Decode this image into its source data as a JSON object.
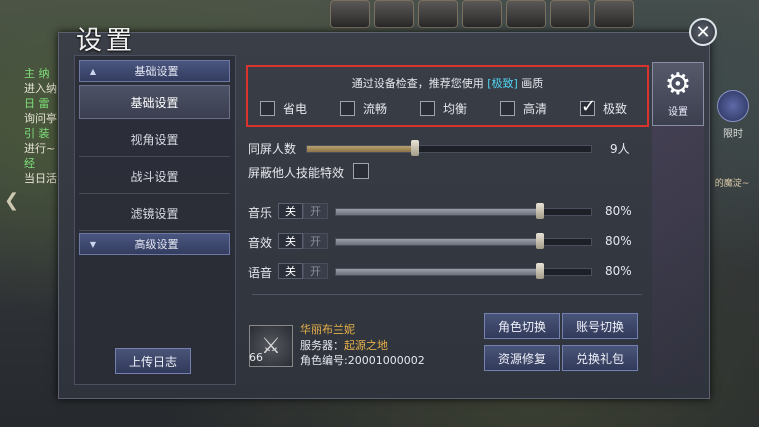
{
  "title": "设置",
  "sidebar": {
    "section_basic": "基础设置",
    "items": [
      "基础设置",
      "视角设置",
      "战斗设置",
      "滤镜设置"
    ],
    "section_advanced": "高级设置",
    "upload_log": "上传日志"
  },
  "settings_tab_label": "设置",
  "quality": {
    "tip_prefix": "通过设备检查，推荐您使用",
    "tip_highlight": "[极致]",
    "tip_suffix": "画质",
    "options": [
      "省电",
      "流畅",
      "均衡",
      "高清",
      "极致"
    ],
    "selected": "极致"
  },
  "same_screen": {
    "label": "同屏人数",
    "value": "9人",
    "level": 0.38
  },
  "hide_skill_effects": {
    "label": "屏蔽他人技能特效",
    "checked": false
  },
  "audio": [
    {
      "label": "音乐",
      "off": "关",
      "on": "开",
      "value": "80%",
      "level": 0.8
    },
    {
      "label": "音效",
      "off": "关",
      "on": "开",
      "value": "80%",
      "level": 0.8
    },
    {
      "label": "语音",
      "off": "关",
      "on": "开",
      "value": "80%",
      "level": 0.8
    }
  ],
  "character": {
    "name": "华丽布兰妮",
    "server_label": "服务器：",
    "server_name": "起源之地",
    "id_text": "角色编号:20001000002",
    "level": "66"
  },
  "buttons": {
    "switch_role": "角色切换",
    "switch_account": "账号切换",
    "repair_resources": "资源修复",
    "redeem_gift": "兑换礼包"
  },
  "hud": {
    "left_lines": [
      "主 纳",
      "进入纳",
      "日 雷",
      "询问亭",
      "引 装",
      "进行~",
      "经",
      "当日活"
    ],
    "right_label": "限时",
    "right_quest": "的魔淀~"
  }
}
